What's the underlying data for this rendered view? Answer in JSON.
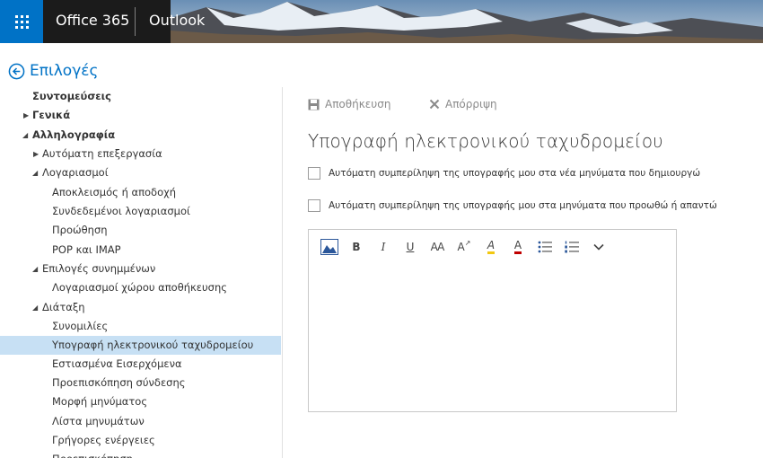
{
  "header": {
    "brand": "Office 365",
    "app": "Outlook"
  },
  "back": {
    "label": "Επιλογές"
  },
  "nav": {
    "items": [
      {
        "label": "Συντομεύσεις"
      },
      {
        "label": "Γενικά"
      },
      {
        "label": "Αλληλογραφία"
      },
      {
        "label": "Αυτόματη επεξεργασία"
      },
      {
        "label": "Λογαριασμοί"
      },
      {
        "label": "Αποκλεισμός ή αποδοχή"
      },
      {
        "label": "Συνδεδεμένοι λογαριασμοί"
      },
      {
        "label": "Προώθηση"
      },
      {
        "label": "POP και IMAP"
      },
      {
        "label": "Επιλογές συνημμένων"
      },
      {
        "label": "Λογαριασμοί χώρου αποθήκευσης"
      },
      {
        "label": "Διάταξη"
      },
      {
        "label": "Συνομιλίες"
      },
      {
        "label": "Υπογραφή ηλεκτρονικού ταχυδρομείου"
      },
      {
        "label": "Εστιασμένα Εισερχόμενα"
      },
      {
        "label": "Προεπισκόπηση σύνδεσης"
      },
      {
        "label": "Μορφή μηνύματος"
      },
      {
        "label": "Λίστα μηνυμάτων"
      },
      {
        "label": "Γρήγορες ενέργειες"
      },
      {
        "label": "Προεπισκόπηση"
      }
    ]
  },
  "commands": {
    "save": "Αποθήκευση",
    "discard": "Απόρριψη"
  },
  "page": {
    "title": "Υπογραφή ηλεκτρονικού ταχυδρομείου",
    "option_new": "Αυτόματη συμπερίληψη της υπογραφής μου στα νέα μηνύματα που δημιουργώ",
    "option_reply": "Αυτόματη συμπερίληψη της υπογραφής μου στα μηνύματα που προωθώ ή απαντώ"
  },
  "toolbar": {
    "bold": "B",
    "italic": "I",
    "underline": "U",
    "font_size": "AA",
    "grow_font": "A",
    "highlight": "A",
    "font_color": "A"
  },
  "colors": {
    "accent": "#0072c6",
    "selected_bg": "#c7e0f4",
    "highlight": "#f2c811",
    "font_color": "#c00000"
  }
}
